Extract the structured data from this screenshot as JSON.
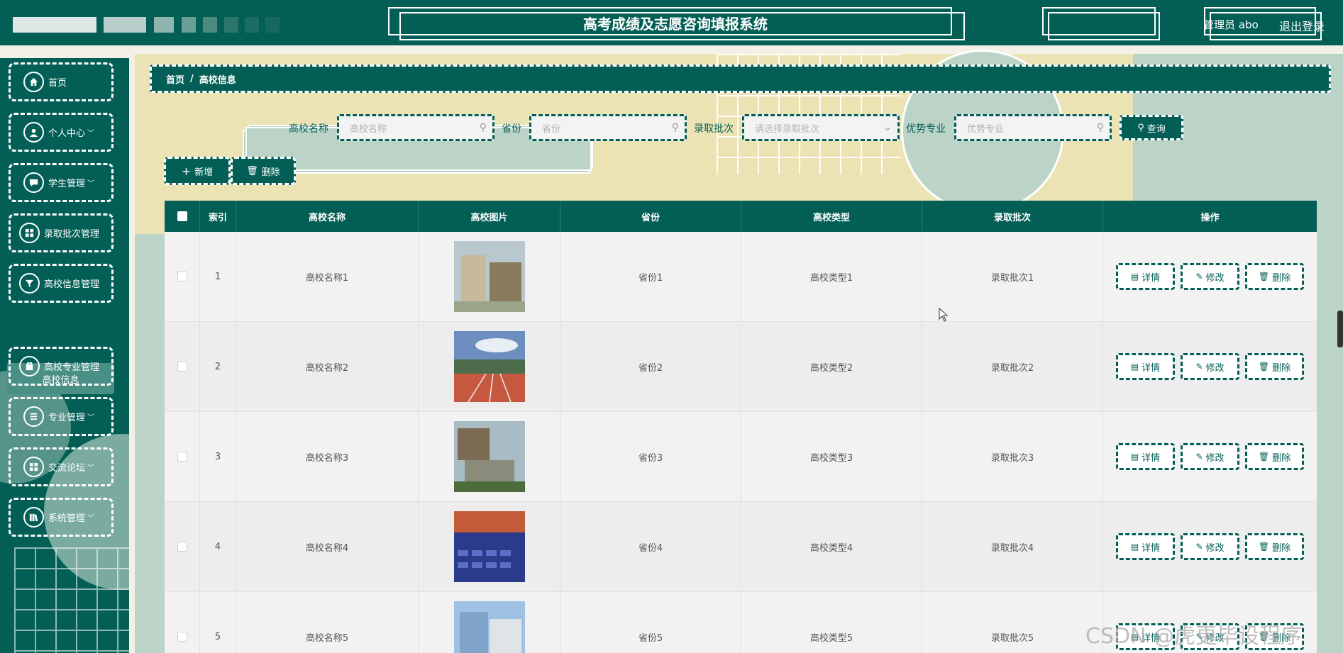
{
  "header": {
    "title": "高考成绩及志愿咨询填报系统",
    "user": "管理员 abo",
    "logout": "退出登录"
  },
  "sidebar": {
    "items": [
      {
        "label": "首页",
        "icon": "home-icon",
        "chevron": ""
      },
      {
        "label": "个人中心",
        "icon": "user-icon",
        "chevron": "﹀"
      },
      {
        "label": "学生管理",
        "icon": "chat-icon",
        "chevron": "﹀"
      },
      {
        "label": "录取批次管理",
        "icon": "grid-icon",
        "chevron": ""
      },
      {
        "label": "高校信息管理",
        "icon": "funnel-icon",
        "chevron": ""
      },
      {
        "label": "高校专业管理",
        "icon": "bag-icon",
        "chevron": ""
      },
      {
        "label": "专业管理",
        "icon": "list-icon",
        "chevron": "﹀"
      },
      {
        "label": "交流论坛",
        "icon": "grid-icon",
        "chevron": "﹀"
      },
      {
        "label": "系统管理",
        "icon": "books-icon",
        "chevron": "﹀"
      }
    ],
    "active_sub": "高校信息"
  },
  "breadcrumb": {
    "home": "首页",
    "separator": "/",
    "current": "高校信息"
  },
  "search": {
    "name_label": "高校名称",
    "name_placeholder": "高校名称",
    "province_label": "省份",
    "province_placeholder": "省份",
    "batch_label": "录取批次",
    "batch_placeholder": "请选择录取批次",
    "major_label": "优势专业",
    "major_placeholder": "优势专业",
    "button": "查询"
  },
  "actions": {
    "add": "新增",
    "delete": "删除"
  },
  "table": {
    "columns": [
      "索引",
      "高校名称",
      "高校图片",
      "省份",
      "高校类型",
      "录取批次",
      "操作"
    ],
    "rows": [
      {
        "index": "1",
        "name": "高校名称1",
        "province": "省份1",
        "type": "高校类型1",
        "batch": "录取批次1"
      },
      {
        "index": "2",
        "name": "高校名称2",
        "province": "省份2",
        "type": "高校类型2",
        "batch": "录取批次2"
      },
      {
        "index": "3",
        "name": "高校名称3",
        "province": "省份3",
        "type": "高校类型3",
        "batch": "录取批次3"
      },
      {
        "index": "4",
        "name": "高校名称4",
        "province": "省份4",
        "type": "高校类型4",
        "batch": "录取批次4"
      },
      {
        "index": "5",
        "name": "高校名称5",
        "province": "省份5",
        "type": "高校类型5",
        "batch": "录取批次5"
      }
    ],
    "row_actions": {
      "detail": "详情",
      "edit": "修改",
      "delete": "删除"
    }
  },
  "watermark": "CSDN @虎更毕设程序",
  "colors": {
    "primary": "#035f56",
    "band": "#ece3b5",
    "mint": "#bcd4c8"
  }
}
